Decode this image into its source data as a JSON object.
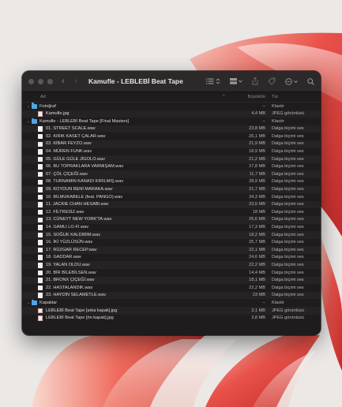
{
  "window": {
    "title": "Kamufle - LEBLEBİ Beat Tape"
  },
  "columns": {
    "name": "Ad",
    "sort_indicator": "⌃",
    "size": "Büyüklük",
    "kind": "Tür"
  },
  "colors": {
    "folder": "#4ea6ea",
    "window_bg": "#1e1c1d",
    "wallpaper_accent": "#e8524a"
  },
  "rows": [
    {
      "kind_type": "folder",
      "level": 0,
      "name": "Fotoğraf",
      "size": "--",
      "kind": "Klasör"
    },
    {
      "kind_type": "jpg",
      "level": 1,
      "name": "Kamufle.jpg",
      "size": "4,4 MB",
      "kind": "JPEG görüntüsü"
    },
    {
      "kind_type": "folder",
      "level": 0,
      "name": "Kamufle - LEBLEBİ Beat Tape [Final Masters]",
      "size": "--",
      "kind": "Klasör"
    },
    {
      "kind_type": "wav",
      "level": 1,
      "name": "01. STREET SCALE.wav",
      "size": "23,8 MB",
      "kind": "Dalga biçimi ses"
    },
    {
      "kind_type": "wav",
      "level": 1,
      "name": "02. KIRIK KASET ÇALAR.wav",
      "size": "26,1 MB",
      "kind": "Dalga biçimi ses"
    },
    {
      "kind_type": "wav",
      "level": 1,
      "name": "03. KİBAR FEYZO.wav",
      "size": "21,9 MB",
      "kind": "Dalga biçimi ses"
    },
    {
      "kind_type": "wav",
      "level": 1,
      "name": "04. MÜREN FUNK.wav",
      "size": "18,9 MB",
      "kind": "Dalga biçimi ses"
    },
    {
      "kind_type": "wav",
      "level": 1,
      "name": "05. GÜLE GÜLE JİGOLO.wav",
      "size": "21,2 MB",
      "kind": "Dalga biçimi ses"
    },
    {
      "kind_type": "wav",
      "level": 1,
      "name": "06. BU TOPRAKLARA VARMIŞAM.wav",
      "size": "27,8 MB",
      "kind": "Dalga biçimi ses"
    },
    {
      "kind_type": "wav",
      "level": 1,
      "name": "07. ÇÖL ÇİÇEĞİ.wav",
      "size": "11,7 MB",
      "kind": "Dalga biçimi ses"
    },
    {
      "kind_type": "wav",
      "level": 1,
      "name": "08. TURNAMIN KANADI KIRILMIŞ.wav",
      "size": "28,9 MB",
      "kind": "Dalga biçimi ses"
    },
    {
      "kind_type": "wav",
      "level": 1,
      "name": "09. KOYDUN BENİ MARAKA.wav",
      "size": "21,7 MB",
      "kind": "Dalga biçimi ses"
    },
    {
      "kind_type": "wav",
      "level": 1,
      "name": "10. BİLMUKABELE (feat. PANGO).wav",
      "size": "34,3 MB",
      "kind": "Dalga biçimi ses"
    },
    {
      "kind_type": "wav",
      "level": 1,
      "name": "11. JACKIE CHAN HESABI.wav",
      "size": "23,5 MB",
      "kind": "Dalga biçimi ses"
    },
    {
      "kind_type": "wav",
      "level": 1,
      "name": "12. FİLTRESİZ.wav",
      "size": "18 MB",
      "kind": "Dalga biçimi ses"
    },
    {
      "kind_type": "wav",
      "level": 1,
      "name": "13. CÜNEYT NEW YORK'TA.wav",
      "size": "25,6 MB",
      "kind": "Dalga biçimi ses"
    },
    {
      "kind_type": "wav",
      "level": 1,
      "name": "14. GAMLI LO-FI.wav",
      "size": "17,3 MB",
      "kind": "Dalga biçimi ses"
    },
    {
      "kind_type": "wav",
      "level": 1,
      "name": "15. SOĞUK KALDIRIM.wav",
      "size": "18,2 MB",
      "kind": "Dalga biçimi ses"
    },
    {
      "kind_type": "wav",
      "level": 1,
      "name": "16. İKİ YÜZLÜSÜN.wav",
      "size": "25,7 MB",
      "kind": "Dalga biçimi ses"
    },
    {
      "kind_type": "wav",
      "level": 1,
      "name": "17. RÜZGAR RECEP.wav",
      "size": "22,1 MB",
      "kind": "Dalga biçimi ses"
    },
    {
      "kind_type": "wav",
      "level": 1,
      "name": "18. GADDAR.wav",
      "size": "24,6 MB",
      "kind": "Dalga biçimi ses"
    },
    {
      "kind_type": "wav",
      "level": 1,
      "name": "19. YALAN OLDU.wav",
      "size": "22,2 MB",
      "kind": "Dalga biçimi ses"
    },
    {
      "kind_type": "wav",
      "level": 1,
      "name": "20. BİR BİLEBİLSEN.wav",
      "size": "14,4 MB",
      "kind": "Dalga biçimi ses"
    },
    {
      "kind_type": "wav",
      "level": 1,
      "name": "21. BRONX ÇİÇEĞİ.wav",
      "size": "18,1 MB",
      "kind": "Dalga biçimi ses"
    },
    {
      "kind_type": "wav",
      "level": 1,
      "name": "22. HASTALANDIK.wav",
      "size": "22,2 MB",
      "kind": "Dalga biçimi ses"
    },
    {
      "kind_type": "wav",
      "level": 1,
      "name": "23. HAYDİN SELAMETLE.wav",
      "size": "23 MB",
      "kind": "Dalga biçimi ses"
    },
    {
      "kind_type": "folder",
      "level": 0,
      "name": "Kapaklar",
      "size": "--",
      "kind": "Klasör"
    },
    {
      "kind_type": "jpg",
      "level": 1,
      "name": "LEBLEBİ Beat Tape [arka kapak].jpg",
      "size": "3,1 MB",
      "kind": "JPEG görüntüsü"
    },
    {
      "kind_type": "jpg",
      "level": 1,
      "name": "LEBLEBİ Beat Tape [ön kapak].jpg",
      "size": "3,8 MB",
      "kind": "JPEG görüntüsü"
    }
  ]
}
